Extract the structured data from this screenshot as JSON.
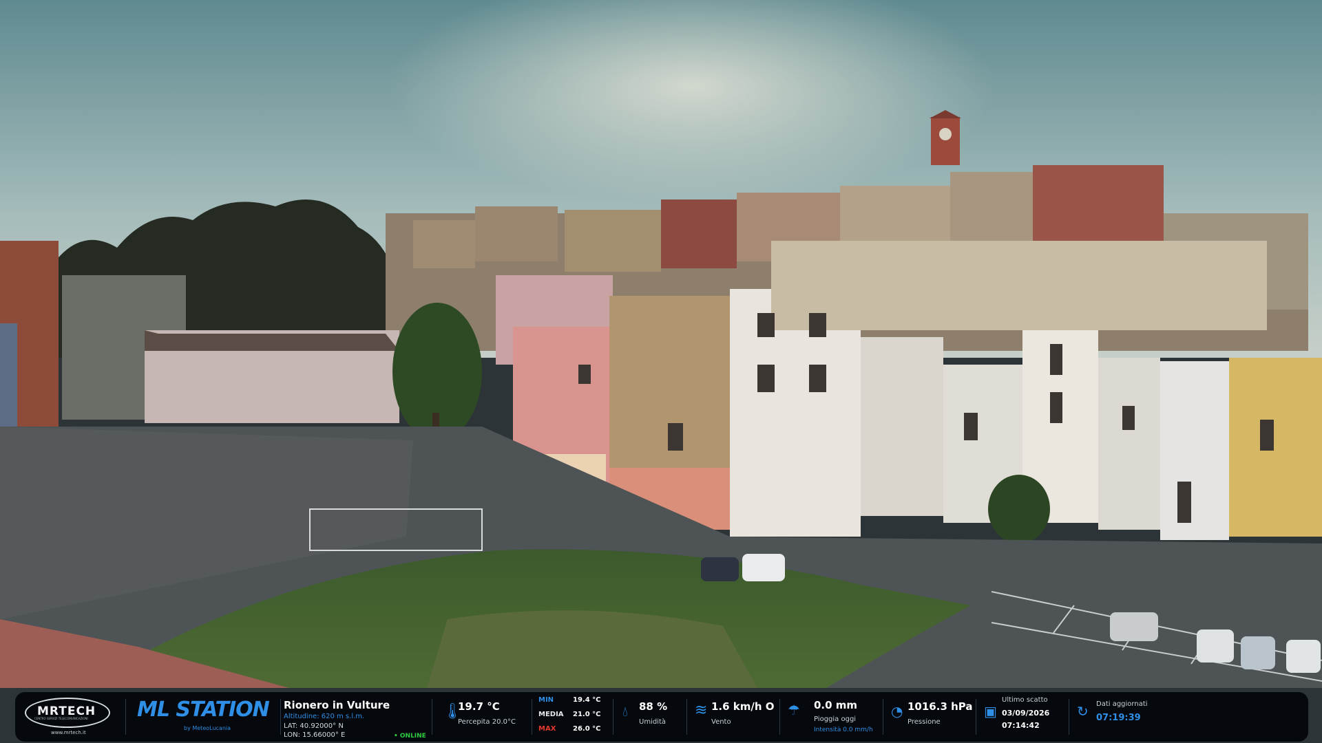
{
  "scene": {
    "description_icon": "webcam-town-square-view"
  },
  "hud": {
    "brand": {
      "mrtech_logo_text": "MRTECH",
      "mrtech_sub": "CENTRO SERVIZI TELECOMUNICAZIONI",
      "mrtech_url": "www.mrtech.it",
      "ml_logo_text": "ML STATION",
      "ml_by": "by MeteoLucania"
    },
    "location": {
      "name": "Rionero in Vulture",
      "altitude": "Altitudine: 620 m s.l.m.",
      "lat": "LAT: 40.92000° N",
      "lon": "LON: 15.66000° E",
      "status": "• ONLINE"
    },
    "temperature": {
      "icon": "thermometer-icon",
      "value": "19.7 °C",
      "feels": "Percepita 20.0°C",
      "min_label": "MIN",
      "min_value": "19.4 °C",
      "avg_label": "MEDIA",
      "avg_value": "21.0 °C",
      "max_label": "MAX",
      "max_value": "26.0 °C"
    },
    "humidity": {
      "icon": "droplet-icon",
      "value": "88 %",
      "label": "Umidità"
    },
    "wind": {
      "icon": "wind-icon",
      "value": "1.6 km/h O",
      "label": "Vento"
    },
    "rain": {
      "icon": "rain-icon",
      "value": "0.0 mm",
      "label": "Pioggia oggi",
      "intensity": "Intensità 0.0 mm/h"
    },
    "pressure": {
      "icon": "gauge-icon",
      "value": "1016.3 hPa",
      "label": "Pressione"
    },
    "snapshot": {
      "icon": "camera-icon",
      "label": "Ultimo scatto",
      "date": "03/09/2026",
      "time": "07:14:42"
    },
    "updated": {
      "icon": "refresh-icon",
      "label": "Dati aggiornati",
      "time": "07:19:39"
    }
  },
  "colors": {
    "accent_blue": "#2f8fe6",
    "min_blue": "#2f8fe6",
    "max_red": "#e2382d",
    "online_green": "#2ecc40"
  }
}
